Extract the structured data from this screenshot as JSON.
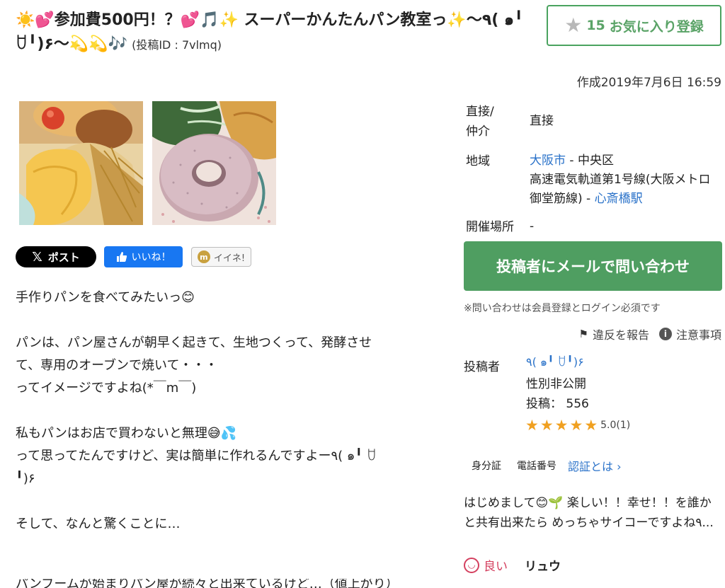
{
  "title": {
    "text": "☀️💕参加費500円！？💕🎵✨ スーパーかんたんパン教室っ✨〜٩( ๑╹ ꇴ╹)۶〜💫💫🎶",
    "post_id": "(投稿ID : 7vlmq)"
  },
  "favorite": {
    "count": "15",
    "label": "お気に入り登録",
    "icon": "star-icon"
  },
  "created": "作成2019年7月6日 16:59",
  "share": {
    "x_label": "ポスト",
    "x_logo": "𝕏",
    "fb_label": "いいね！",
    "m_label": "イイネ!",
    "m_logo": "m"
  },
  "body_lines": [
    "手作りパンを食べてみたいっ😊",
    "",
    "パンは、パン屋さんが朝早く起きて、生地つくって、発酵させ",
    "て、専用のオーブンで焼いて・・・",
    "ってイメージですよね(*￣m￣)",
    "",
    "私もパンはお店で買わないと無理😅💦",
    "って思ってたんですけど、実は簡単に作れるんですよー٩( ๑╹ ꇴ",
    "╹)۶",
    "",
    "そして、なんと驚くことに…"
  ],
  "body_cut": "パンブームが始まりパン屋が続々と出来ているけど…（値上がり）",
  "info": {
    "type_label": "直接/仲介",
    "type_value": "直接",
    "region_label": "地域",
    "region_city": "大阪市",
    "region_sep": " - 中央区",
    "region_line": "高速電気軌道第1号線(大阪メトロ御堂筋線) - ",
    "region_station": "心斎橋駅",
    "venue_label": "開催場所",
    "venue_value": "-"
  },
  "contact_button": "投稿者にメールで問い合わせ",
  "contact_note": "※問い合わせは会員登録とログイン必須です",
  "report": {
    "report_label": "違反を報告",
    "caution_label": "注意事項"
  },
  "poster": {
    "label": "投稿者",
    "name": "٩( ๑╹ ꇴ╹)۶",
    "gender": "性別非公開",
    "posts": "投稿： 556",
    "rating": 5.0,
    "rating_text": "5.0(1)"
  },
  "verify": {
    "id_label": "身分証",
    "phone_label": "電話番号",
    "what_label": "認証とは ›"
  },
  "intro": "はじめまして😊🌱 楽しい！！幸せ！！を誰かと共有出来たら めっちゃサイコーですよね٩...",
  "review": {
    "good_label": "良い",
    "reviewer": "リュウ"
  },
  "colors": {
    "green": "#4f9e61",
    "link": "#2a72c9",
    "star": "#f0a020",
    "good": "#d4405f"
  }
}
